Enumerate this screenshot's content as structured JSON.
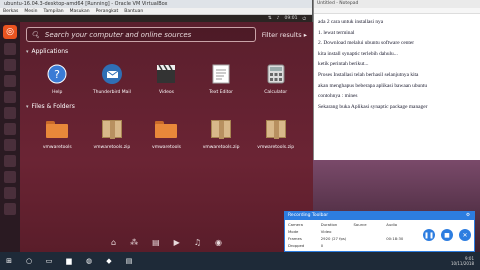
{
  "vbox": {
    "title": "ubuntu-16.04.3-desktop-amd64 [Running] - Oracle VM VirtualBox",
    "menu": [
      "Berkas",
      "Mesin",
      "Tampilan",
      "Masukan",
      "Perangkat",
      "Bantuan"
    ]
  },
  "topbar": {
    "time": "09:01"
  },
  "dash": {
    "search_placeholder": "Search your computer and online sources",
    "filter_label": "Filter results",
    "sections": {
      "applications": "Applications",
      "files": "Files & Folders"
    },
    "apps": [
      {
        "label": "Help",
        "icon": "help-icon"
      },
      {
        "label": "Thunderbird Mail",
        "icon": "thunderbird-icon"
      },
      {
        "label": "Videos",
        "icon": "videos-icon"
      },
      {
        "label": "Text Editor",
        "icon": "text-editor-icon"
      },
      {
        "label": "Calculator",
        "icon": "calculator-icon"
      }
    ],
    "files": [
      {
        "label": "vmwaretools",
        "icon": "folder-icon"
      },
      {
        "label": "vmwaretools.zip",
        "icon": "archive-icon"
      },
      {
        "label": "vmwaretools",
        "icon": "folder-icon"
      },
      {
        "label": "vmwaretools.zip",
        "icon": "archive-icon"
      },
      {
        "label": "vmwaretools.zip",
        "icon": "archive-icon"
      }
    ]
  },
  "notepad": {
    "title": "Untitled - Notepad",
    "lines": [
      "ada 2 cara untuk installasi nya",
      "1. lewat terminal",
      "2. Download melalui ubuntu software center",
      "kita install synaptic terlebih dahulu...",
      "ketik perintah berikut...",
      "Proses Installasi telah berhasil selanjutnya kita",
      "akan menghapus beberapa aplikasi bawaan ubuntu",
      "contohnya : mines",
      "Sekarang buka Aplikasi synaptic package manager"
    ]
  },
  "recorder": {
    "title": "Recording Toolbar",
    "headers": [
      "Camera",
      "Duration",
      "Source",
      "Audio"
    ],
    "rows": [
      [
        "Mode",
        "Video",
        "",
        ""
      ],
      [
        "Frames",
        "2920 (27 fps)",
        "",
        "00:18:30"
      ],
      [
        "Dropped",
        "0",
        "",
        ""
      ]
    ]
  },
  "taskbar": {
    "tray_time": "9:01",
    "tray_date": "10/11/2018"
  }
}
